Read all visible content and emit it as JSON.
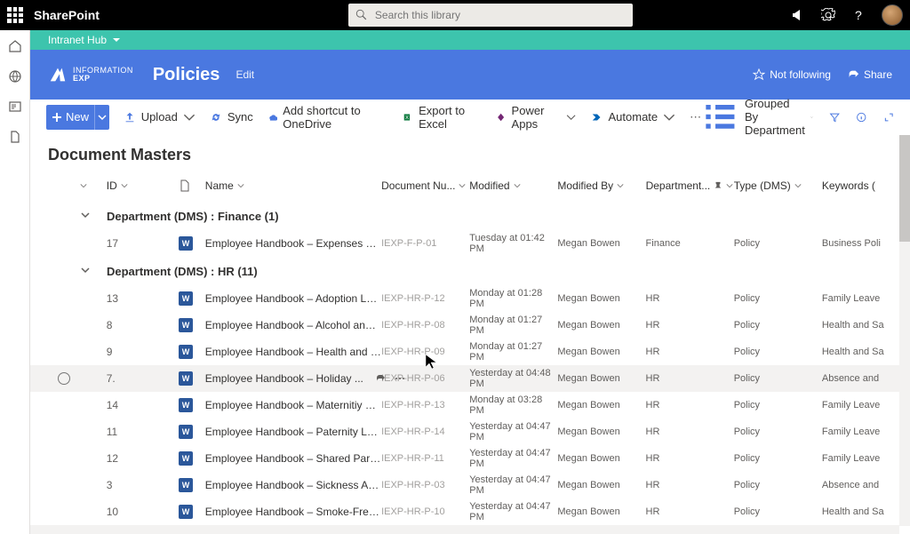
{
  "suite": {
    "app": "SharePoint",
    "search_placeholder": "Search this library"
  },
  "hub": {
    "name": "Intranet Hub"
  },
  "site": {
    "logo_line1": "INFORMATION",
    "logo_line2": "EXP",
    "title": "Policies",
    "edit": "Edit",
    "not_following": "Not following",
    "share": "Share"
  },
  "cmd": {
    "new": "New",
    "upload": "Upload",
    "sync": "Sync",
    "shortcut": "Add shortcut to OneDrive",
    "excel": "Export to Excel",
    "powerapps": "Power Apps",
    "automate": "Automate",
    "view": "Grouped By Department"
  },
  "list": {
    "title": "Document Masters",
    "cols": {
      "id": "ID",
      "name": "Name",
      "docnum": "Document Nu...",
      "modified": "Modified",
      "modby": "Modified By",
      "dept": "Department...",
      "type": "Type (DMS)",
      "keywords": "Keywords ("
    },
    "group_prefix": "Department (DMS) : ",
    "groups": [
      {
        "label": "Finance (1)",
        "rows": [
          {
            "id": "17",
            "name": "Employee Handbook – Expenses Policy and...",
            "doc": "IEXP-F-P-01",
            "mod": "Tuesday at 01:42 PM",
            "by": "Megan Bowen",
            "dept": "Finance",
            "type": "Policy",
            "key": "Business Poli"
          }
        ]
      },
      {
        "label": "HR (11)",
        "rows": [
          {
            "id": "13",
            "name": "Employee Handbook – Adoption Leave.docx",
            "doc": "IEXP-HR-P-12",
            "mod": "Monday at 01:28 PM",
            "by": "Megan Bowen",
            "dept": "HR",
            "type": "Policy",
            "key": "Family Leave"
          },
          {
            "id": "8",
            "name": "Employee Handbook – Alcohol and Drugs P...",
            "doc": "IEXP-HR-P-08",
            "mod": "Monday at 01:27 PM",
            "by": "Megan Bowen",
            "dept": "HR",
            "type": "Policy",
            "key": "Health and Sa"
          },
          {
            "id": "9",
            "name": "Employee Handbook – Health and Safety.d...",
            "doc": "IEXP-HR-P-09",
            "mod": "Monday at 01:27 PM",
            "by": "Megan Bowen",
            "dept": "HR",
            "type": "Policy",
            "key": "Health and Sa"
          },
          {
            "id": "7.",
            "name": "Employee Handbook – Holiday ...",
            "doc": "IEXP-HR-P-06",
            "mod": "Yesterday at 04:48 PM",
            "by": "Megan Bowen",
            "dept": "HR",
            "type": "Policy",
            "key": "Absence and",
            "hov": true
          },
          {
            "id": "14",
            "name": "Employee Handbook – Maternitiy Leave an...",
            "doc": "IEXP-HR-P-13",
            "mod": "Monday at 03:28 PM",
            "by": "Megan Bowen",
            "dept": "HR",
            "type": "Policy",
            "key": "Family Leave"
          },
          {
            "id": "11",
            "name": "Employee Handbook – Paternity Leave and ...",
            "doc": "IEXP-HR-P-14",
            "mod": "Yesterday at 04:47 PM",
            "by": "Megan Bowen",
            "dept": "HR",
            "type": "Policy",
            "key": "Family Leave"
          },
          {
            "id": "12",
            "name": "Employee Handbook – Shared Parental Lea...",
            "doc": "IEXP-HR-P-11",
            "mod": "Yesterday at 04:47 PM",
            "by": "Megan Bowen",
            "dept": "HR",
            "type": "Policy",
            "key": "Family Leave"
          },
          {
            "id": "3",
            "name": "Employee Handbook – Sickness Absence P...",
            "doc": "IEXP-HR-P-03",
            "mod": "Yesterday at 04:47 PM",
            "by": "Megan Bowen",
            "dept": "HR",
            "type": "Policy",
            "key": "Absence and"
          },
          {
            "id": "10",
            "name": "Employee Handbook – Smoke-Free Policy.d...",
            "doc": "IEXP-HR-P-10",
            "mod": "Yesterday at 04:47 PM",
            "by": "Megan Bowen",
            "dept": "HR",
            "type": "Policy",
            "key": "Health and Sa"
          }
        ]
      }
    ]
  }
}
